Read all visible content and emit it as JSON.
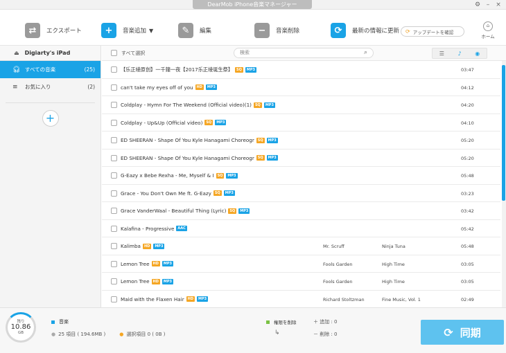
{
  "window": {
    "title": "DearMob iPhone音楽マネージャー",
    "settings_icon": "⚙",
    "minimize_icon": "–",
    "close_icon": "×"
  },
  "toolbar": {
    "export_label": "エクスポート",
    "add_label": "音楽追加",
    "edit_label": "編集",
    "delete_label": "音楽削除",
    "refresh_label": "最新の情報に更新",
    "update_check_label": "アップデートを確認",
    "home_label": "ホーム"
  },
  "sidebar": {
    "device": "Digiarty's iPad",
    "items": [
      {
        "label": "すべての音楽",
        "count": "(25)",
        "active": true
      },
      {
        "label": "お気に入り",
        "count": "(2)",
        "active": false
      }
    ],
    "add_symbol": "+"
  },
  "list": {
    "select_all_label": "すべて選択",
    "search_placeholder": "検索",
    "rows": [
      {
        "title": "【乐正绫原创】一千鐘一夜【2017乐正绫诞生祭】",
        "badges": [
          "SQ",
          "MP3"
        ],
        "artist": "",
        "album": "",
        "duration": "03:47"
      },
      {
        "title": "can't take my eyes off of you",
        "badges": [
          "HD",
          "MP3"
        ],
        "artist": "",
        "album": "",
        "duration": "04:12"
      },
      {
        "title": "Coldplay - Hymn For The Weekend (Official video)(1)",
        "badges": [
          "SQ",
          "MP3"
        ],
        "artist": "",
        "album": "",
        "duration": "04:20"
      },
      {
        "title": "Coldplay - Up&Up (Official video)",
        "badges": [
          "SQ",
          "MP3"
        ],
        "artist": "",
        "album": "",
        "duration": "04:10"
      },
      {
        "title": "ED SHEERAN - Shape Of You   Kyle Hanagami Choreogr",
        "badges": [
          "SQ",
          "MP3"
        ],
        "artist": "",
        "album": "",
        "duration": "05:20"
      },
      {
        "title": "ED SHEERAN - Shape Of You   Kyle Hanagami Choreogr",
        "badges": [
          "SQ",
          "MP3"
        ],
        "artist": "",
        "album": "",
        "duration": "05:20"
      },
      {
        "title": "G-Eazy x Bebe Rexha - Me, Myself & I",
        "badges": [
          "SQ",
          "MP3"
        ],
        "artist": "",
        "album": "",
        "duration": "05:48"
      },
      {
        "title": "Grace - You Don't Own Me ft. G-Eazy",
        "badges": [
          "SQ",
          "MP3"
        ],
        "artist": "",
        "album": "",
        "duration": "03:23"
      },
      {
        "title": "Grace VanderWaal - Beautiful Thing (Lyric)",
        "badges": [
          "SQ",
          "MP3"
        ],
        "artist": "",
        "album": "",
        "duration": "03:42"
      },
      {
        "title": "Kalafina - Progressive",
        "badges": [
          "AAC"
        ],
        "artist": "",
        "album": "",
        "duration": "05:42"
      },
      {
        "title": "Kalimba",
        "badges": [
          "HD",
          "MP3"
        ],
        "artist": "Mr. Scruff",
        "album": "Ninja Tuna",
        "duration": "05:48"
      },
      {
        "title": "Lemon Tree",
        "badges": [
          "HD",
          "MP3"
        ],
        "artist": "Fools Garden",
        "album": "High Time",
        "duration": "03:05"
      },
      {
        "title": "Lemon Tree",
        "badges": [
          "HD",
          "MP3"
        ],
        "artist": "Fools Garden",
        "album": "High Time",
        "duration": "03:05"
      },
      {
        "title": "Maid with the Flaxen Hair",
        "badges": [
          "HD",
          "MP3"
        ],
        "artist": "Richard Stoltzman",
        "album": "Fine Music, Vol. 1",
        "duration": "02:49"
      }
    ]
  },
  "footer": {
    "storage_remaining_label": "残り",
    "storage_value": "10.86",
    "storage_unit": "GB",
    "category_label": "音楽",
    "items_summary": "25 項目 ( 194.6MB )",
    "selected_summary": "選択項目 0 ( 0B )",
    "permission_delete_label": "権限を削除",
    "add_summary": "追加 : 0",
    "delete_summary": "削除 : 0",
    "sync_label": "同期"
  },
  "colors": {
    "accent": "#1aa3e6",
    "badge_quality": "#f5a623",
    "badge_format": "#1aa3e6",
    "sync": "#5ec2ef"
  }
}
